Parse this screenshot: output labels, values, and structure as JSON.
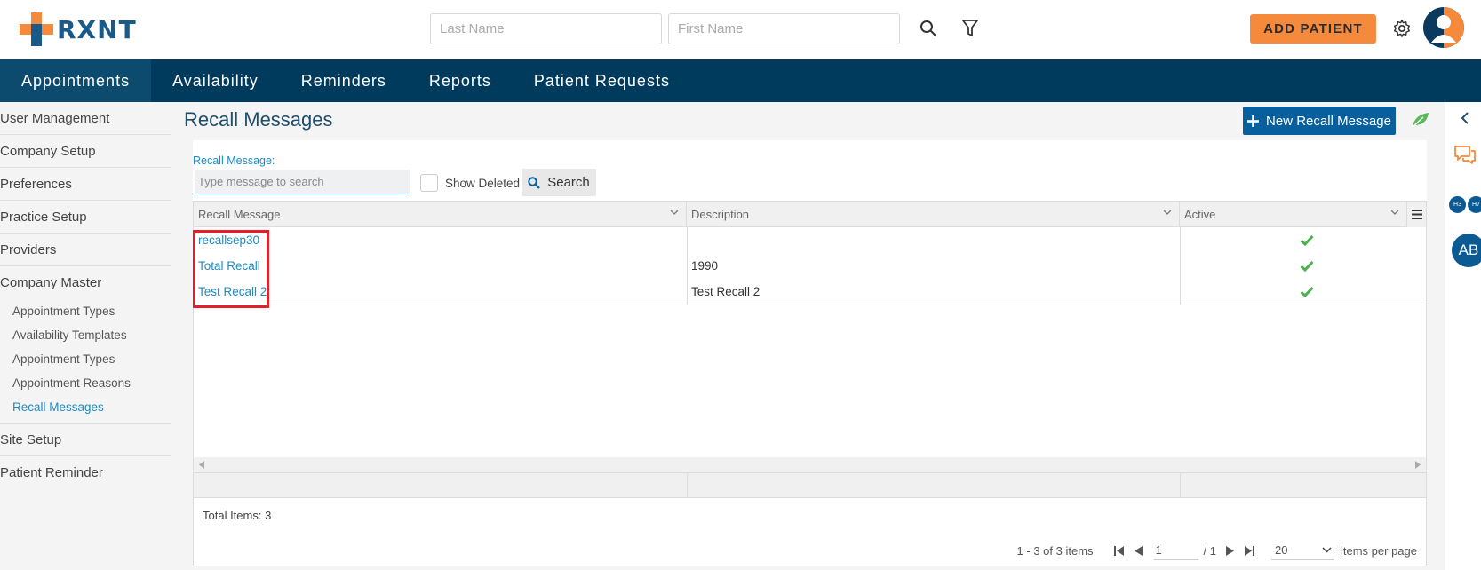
{
  "brand": {
    "name": "RXNT",
    "accent": "#f58a3c",
    "primary": "#003a5c"
  },
  "header": {
    "last_name_placeholder": "Last Name",
    "first_name_placeholder": "First Name",
    "add_patient_label": "ADD PATIENT"
  },
  "nav": {
    "items": [
      {
        "label": "Appointments"
      },
      {
        "label": "Availability"
      },
      {
        "label": "Reminders"
      },
      {
        "label": "Reports"
      },
      {
        "label": "Patient Requests"
      }
    ]
  },
  "sidebar": {
    "items": [
      {
        "label": "User Management"
      },
      {
        "label": "Company Setup"
      },
      {
        "label": "Preferences"
      },
      {
        "label": "Practice Setup"
      },
      {
        "label": "Providers"
      },
      {
        "label": "Company Master"
      },
      {
        "label": "Site Setup"
      },
      {
        "label": "Patient Reminder"
      }
    ],
    "subitems": [
      {
        "label": "Appointment Types"
      },
      {
        "label": "Availability Templates"
      },
      {
        "label": "Appointment Types"
      },
      {
        "label": "Appointment Reasons"
      },
      {
        "label": "Recall Messages"
      }
    ]
  },
  "main": {
    "title": "Recall Messages",
    "new_button_label": "New Recall Message",
    "filter": {
      "label": "Recall Message:",
      "placeholder": "Type message to search",
      "show_deleted_label": "Show Deleted",
      "search_label": "Search"
    },
    "grid": {
      "columns": [
        "Recall Message",
        "Description",
        "Active"
      ],
      "rows": [
        {
          "message": "recallsep30",
          "description": "",
          "active": true
        },
        {
          "message": "Total Recall",
          "description": "1990",
          "active": true
        },
        {
          "message": "Test Recall 2",
          "description": "Test Recall 2",
          "active": true
        }
      ],
      "total_items": "Total Items: 3",
      "pager": {
        "range": "1 - 3 of 3 items",
        "page": "1",
        "page_total": "/ 1",
        "page_size": "20",
        "per_page_label": "items per page"
      }
    }
  },
  "right_rail": {
    "badges": [
      "H3",
      "H7"
    ],
    "avatar_initials": "AB"
  }
}
